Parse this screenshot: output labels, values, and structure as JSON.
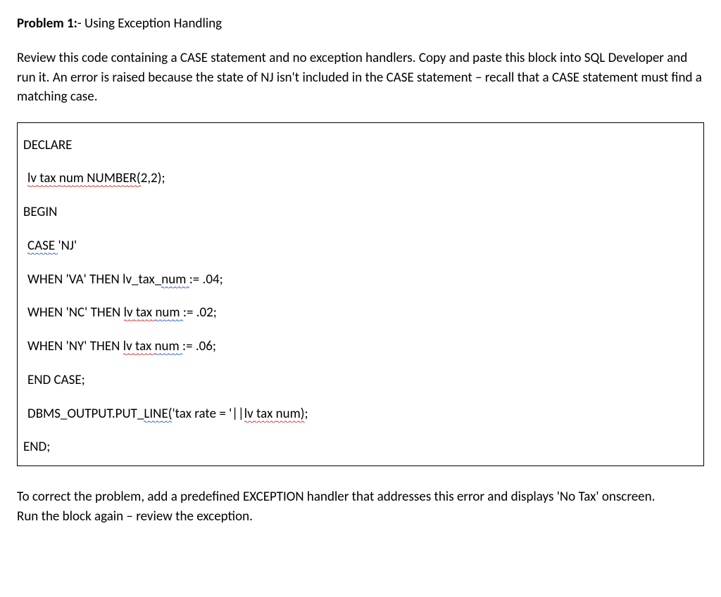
{
  "heading": {
    "label": "Problem 1:",
    "title": "- Using Exception Handling"
  },
  "intro": "Review this code containing a CASE statement and no exception handlers. Copy and paste this block into SQL Developer and run it. An error is raised because the state of NJ isn't included in the CASE statement – recall that a CASE statement must find a matching case.",
  "code": {
    "declare": "DECLARE",
    "var_a": "lv",
    "var_b": " tax ",
    "var_c": "num",
    "var_d": " NUMBER(",
    "var_e": "2,2);",
    "begin": "BEGIN",
    "case_a": "CASE ",
    "case_b": "'NJ'",
    "when1_a": "WHEN 'VA' THEN lv_tax_",
    "when1_b": "num ",
    "when1_c": ":= .04;",
    "when2_a": "WHEN 'NC' THEN ",
    "when2_b": "lv",
    "when2_c": " tax ",
    "when2_d": "num ",
    "when2_e": ":= .02;",
    "when3_a": "WHEN 'NY' THEN ",
    "when3_b": "lv",
    "when3_c": " tax ",
    "when3_d": "num ",
    "when3_e": ":= .06;",
    "endcase": "END CASE;",
    "dbms_a": "DBMS_OUTPUT.PUT_",
    "dbms_b": "LINE(",
    "dbms_c": "'tax rate = '||",
    "dbms_d": "lv",
    "dbms_e": " tax ",
    "dbms_f": "num)",
    "dbms_g": ";",
    "end": "END;"
  },
  "outro": {
    "l1": "To correct the problem, add a predefined EXCEPTION handler that addresses this error and displays 'No Tax' onscreen.",
    "l2": "Run the block again – review the exception."
  }
}
